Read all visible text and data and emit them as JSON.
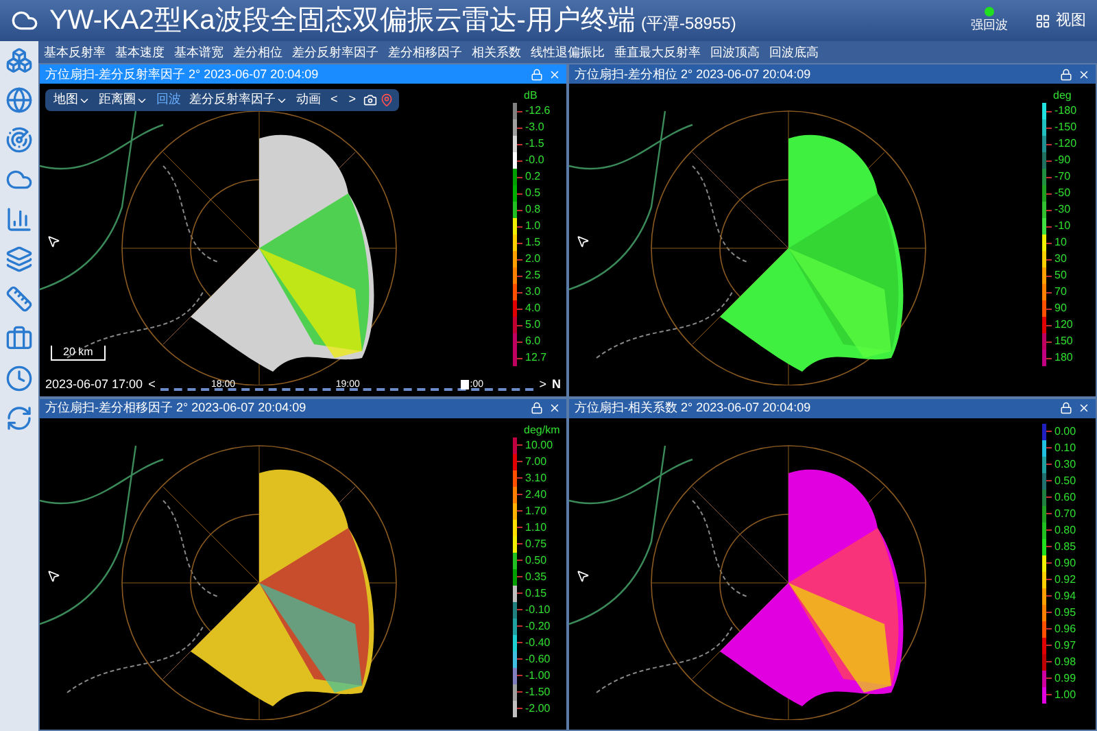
{
  "header": {
    "title": "YW-KA2型Ka波段全固态双偏振云雷达-用户终端",
    "station": "(平潭-58955)",
    "status": {
      "label": "强回波",
      "on": true
    },
    "view_button": "视图"
  },
  "menu": [
    "基本反射率",
    "基本速度",
    "基本谱宽",
    "差分相位",
    "差分反射率因子",
    "差分相移因子",
    "相关系数",
    "线性退偏振比",
    "垂直最大反射率",
    "回波顶高",
    "回波底高"
  ],
  "panels": [
    {
      "title": "方位扇扫-差分反射率因子 2° 2023-06-07 20:04:09",
      "selected": true,
      "kind": "zdr",
      "toolbar": {
        "items": [
          {
            "kind": "dropdown",
            "label": "地图"
          },
          {
            "kind": "dropdown",
            "label": "距离圈"
          },
          {
            "kind": "toggle",
            "label": "回波"
          },
          {
            "kind": "dropdown",
            "label": "差分反射率因子"
          },
          {
            "kind": "button",
            "label": "动画"
          },
          {
            "kind": "prev",
            "label": "<"
          },
          {
            "kind": "next",
            "label": ">"
          },
          {
            "kind": "camera"
          },
          {
            "kind": "pin"
          }
        ]
      },
      "scale": "20 km",
      "timeline": {
        "start": "2023-06-07 17:00",
        "prev": "<",
        "ticks": [
          "18:00",
          "19:00",
          ":00"
        ],
        "next": ">",
        "north": "N"
      },
      "legend": {
        "unit": "dB",
        "entries": [
          {
            "label": "-12.6",
            "color": "#808080"
          },
          {
            "label": "-3.0",
            "color": "#a0a0a0"
          },
          {
            "label": "-1.5",
            "color": "#d8d8d8"
          },
          {
            "label": "-0.0",
            "color": "#ffffff"
          },
          {
            "label": "0.2",
            "color": "#00a000"
          },
          {
            "label": "0.5",
            "color": "#00b000"
          },
          {
            "label": "0.8",
            "color": "#20c020"
          },
          {
            "label": "1.0",
            "color": "#f0f000"
          },
          {
            "label": "1.5",
            "color": "#ffd000"
          },
          {
            "label": "2.0",
            "color": "#ffa000"
          },
          {
            "label": "2.5",
            "color": "#ff8000"
          },
          {
            "label": "3.0",
            "color": "#ff5000"
          },
          {
            "label": "4.0",
            "color": "#e00000"
          },
          {
            "label": "5.0",
            "color": "#c00030"
          },
          {
            "label": "6.0",
            "color": "#c00060"
          },
          {
            "label": "12.7",
            "color": "#c00060"
          }
        ]
      }
    },
    {
      "title": "方位扇扫-差分相位 2° 2023-06-07 20:04:09",
      "selected": false,
      "kind": "phidp",
      "legend": {
        "unit": "deg",
        "entries": [
          {
            "label": "-180",
            "color": "#20e0e0"
          },
          {
            "label": "-150",
            "color": "#20c0c0"
          },
          {
            "label": "-120",
            "color": "#209090"
          },
          {
            "label": "-90",
            "color": "#207060"
          },
          {
            "label": "-70",
            "color": "#209040"
          },
          {
            "label": "-50",
            "color": "#20a020"
          },
          {
            "label": "-30",
            "color": "#30c030"
          },
          {
            "label": "-10",
            "color": "#40e040"
          },
          {
            "label": "10",
            "color": "#f0f000"
          },
          {
            "label": "30",
            "color": "#ffd000"
          },
          {
            "label": "50",
            "color": "#ffa000"
          },
          {
            "label": "70",
            "color": "#ff8000"
          },
          {
            "label": "90",
            "color": "#ff5000"
          },
          {
            "label": "120",
            "color": "#e00000"
          },
          {
            "label": "150",
            "color": "#c00060"
          },
          {
            "label": "180",
            "color": "#c00080"
          }
        ]
      }
    },
    {
      "title": "方位扇扫-差分相移因子 2° 2023-06-07 20:04:09",
      "selected": false,
      "kind": "kdp",
      "legend": {
        "unit": "deg/km",
        "entries": [
          {
            "label": "10.00",
            "color": "#c00040"
          },
          {
            "label": "7.00",
            "color": "#e00000"
          },
          {
            "label": "3.10",
            "color": "#ff5000"
          },
          {
            "label": "2.40",
            "color": "#ff8000"
          },
          {
            "label": "1.70",
            "color": "#ffb000"
          },
          {
            "label": "1.10",
            "color": "#ffe000"
          },
          {
            "label": "0.75",
            "color": "#f0f000"
          },
          {
            "label": "0.50",
            "color": "#20c020"
          },
          {
            "label": "0.35",
            "color": "#00a000"
          },
          {
            "label": "0.15",
            "color": "#c0c0c0"
          },
          {
            "label": "-0.10",
            "color": "#208080"
          },
          {
            "label": "-0.20",
            "color": "#20a0a0"
          },
          {
            "label": "-0.40",
            "color": "#20d0d0"
          },
          {
            "label": "-0.60",
            "color": "#40c0e0"
          },
          {
            "label": "-1.00",
            "color": "#8080c0"
          },
          {
            "label": "-1.50",
            "color": "#a0a0a0"
          },
          {
            "label": "-2.00",
            "color": "#c0c0c0"
          }
        ]
      }
    },
    {
      "title": "方位扇扫-相关系数 2° 2023-06-07 20:04:09",
      "selected": false,
      "kind": "cc",
      "legend": {
        "entries": [
          {
            "label": "0.00",
            "color": "#2020c0"
          },
          {
            "label": "0.10",
            "color": "#20c0e0"
          },
          {
            "label": "0.30",
            "color": "#20a0a0"
          },
          {
            "label": "0.50",
            "color": "#207070"
          },
          {
            "label": "0.60",
            "color": "#208040"
          },
          {
            "label": "0.70",
            "color": "#20a020"
          },
          {
            "label": "0.80",
            "color": "#20c020"
          },
          {
            "label": "0.85",
            "color": "#20e020"
          },
          {
            "label": "0.90",
            "color": "#f0f000"
          },
          {
            "label": "0.92",
            "color": "#ffd000"
          },
          {
            "label": "0.94",
            "color": "#ffa000"
          },
          {
            "label": "0.95",
            "color": "#ff8000"
          },
          {
            "label": "0.96",
            "color": "#ff5000"
          },
          {
            "label": "0.97",
            "color": "#e00000"
          },
          {
            "label": "0.98",
            "color": "#c00000"
          },
          {
            "label": "0.99",
            "color": "#d000a0"
          },
          {
            "label": "1.00",
            "color": "#e000e0"
          }
        ]
      }
    }
  ]
}
